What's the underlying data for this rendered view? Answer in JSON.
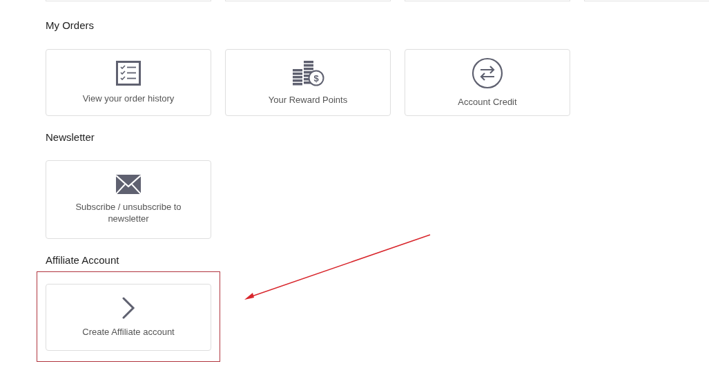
{
  "sections": [
    {
      "title": "My Orders",
      "highlighted": false,
      "items": [
        {
          "kind": "list",
          "label": "View your order history"
        },
        {
          "kind": "coins",
          "symbol": "$",
          "label": "Your Reward Points"
        },
        {
          "kind": "exchange",
          "label": "Account Credit"
        }
      ]
    },
    {
      "title": "Newsletter",
      "highlighted": false,
      "items": [
        {
          "kind": "mail",
          "label": "Subscribe / unsubscribe to newsletter"
        }
      ]
    },
    {
      "title": "Affiliate Account",
      "highlighted": true,
      "items": [
        {
          "kind": "chevron",
          "label": "Create Affiliate account"
        }
      ]
    }
  ]
}
